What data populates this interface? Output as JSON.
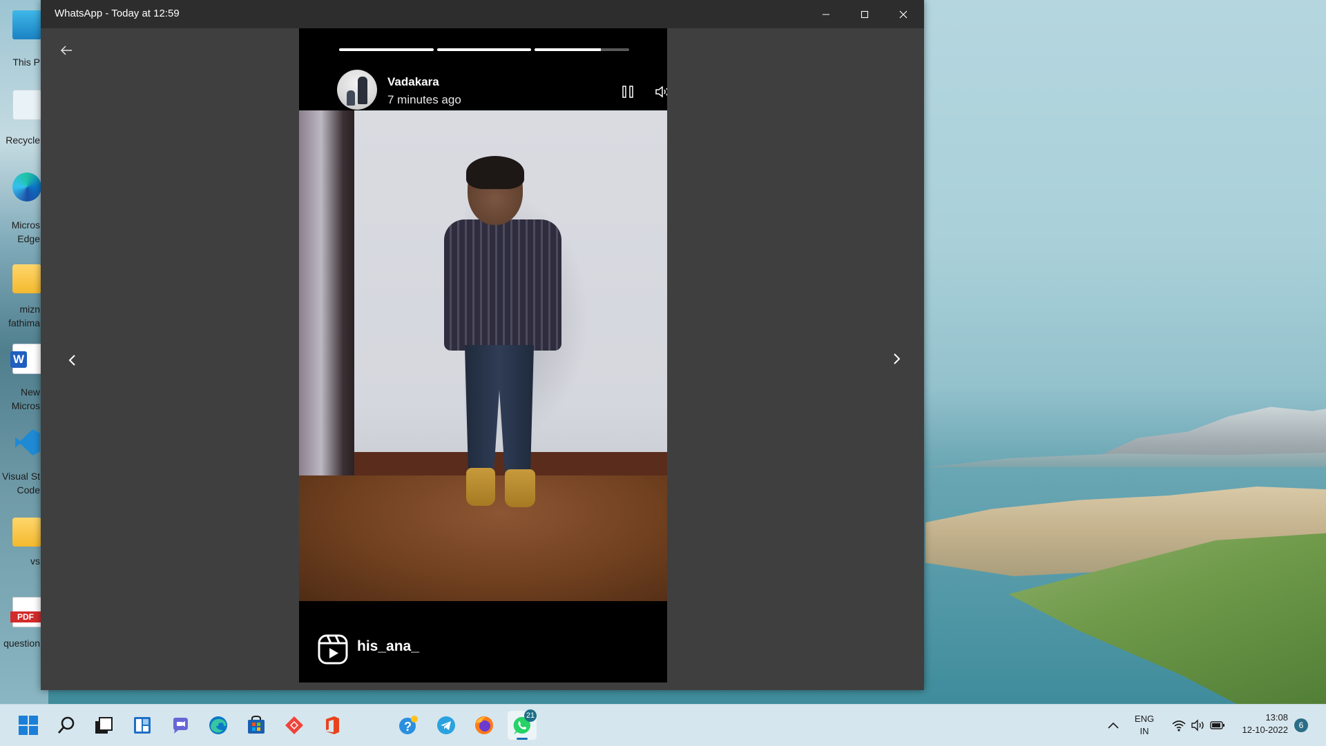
{
  "window": {
    "title": "WhatsApp - Today at 12:59"
  },
  "desktop": {
    "icons": [
      {
        "label": "This P"
      },
      {
        "label": "Recycle"
      },
      {
        "label": "Micros\nEdge"
      },
      {
        "label": "mizn\nfathima"
      },
      {
        "label": "New\nMicros"
      },
      {
        "label": "Visual St\nCode"
      },
      {
        "label": "vs"
      },
      {
        "label": "question"
      }
    ]
  },
  "status": {
    "contact_name": "Vadakara",
    "posted_ago": "7 minutes ago",
    "progress": [
      1.0,
      1.0,
      0.7
    ],
    "reel_username": "his_ana_"
  },
  "taskbar": {
    "apps": [
      {
        "name": "start",
        "icon": "windows-logo-icon"
      },
      {
        "name": "search",
        "icon": "search-icon"
      },
      {
        "name": "task-view",
        "icon": "task-view-icon"
      },
      {
        "name": "widgets",
        "icon": "widgets-icon"
      },
      {
        "name": "teams-chat",
        "icon": "chat-icon"
      },
      {
        "name": "edge",
        "icon": "edge-icon"
      },
      {
        "name": "store",
        "icon": "store-icon"
      },
      {
        "name": "anydesk",
        "icon": "anydesk-icon"
      },
      {
        "name": "office",
        "icon": "office-icon"
      },
      {
        "name": "get-help",
        "icon": "help-icon"
      },
      {
        "name": "telegram",
        "icon": "telegram-icon"
      },
      {
        "name": "firefox",
        "icon": "firefox-icon"
      },
      {
        "name": "whatsapp",
        "icon": "whatsapp-icon",
        "badge": "21",
        "active": true
      }
    ],
    "tray": {
      "language_line1": "ENG",
      "language_line2": "IN",
      "time": "13:08",
      "date": "12-10-2022",
      "notifications": "6"
    }
  }
}
